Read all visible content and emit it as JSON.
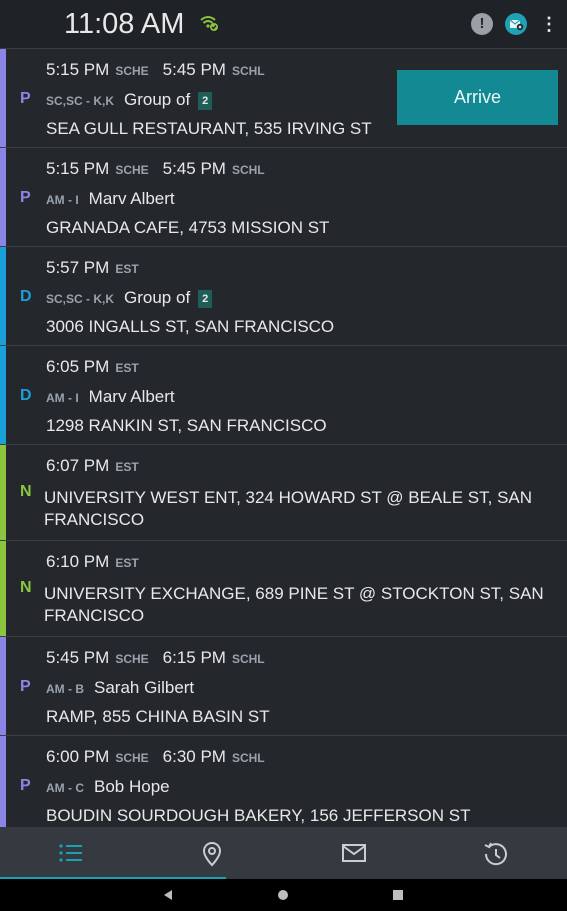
{
  "status": {
    "time": "11:08 AM",
    "alert_glyph": "!",
    "menu_glyph": "⋮"
  },
  "colors": {
    "pickup": "#8b86e6",
    "dropoff": "#1aa0d8",
    "note": "#8cc63f",
    "accent": "#138a93"
  },
  "rows": [
    {
      "type": "P",
      "time1": "5:15 PM",
      "tag1": "SCHE",
      "time2": "5:45 PM",
      "tag2": "SCHL",
      "code": "SC,SC - K,K",
      "name": "Group of",
      "count": "2",
      "address": "SEA GULL RESTAURANT, 535 IRVING ST",
      "action": "Arrive"
    },
    {
      "type": "P",
      "time1": "5:15 PM",
      "tag1": "SCHE",
      "time2": "5:45 PM",
      "tag2": "SCHL",
      "code": "AM - I",
      "name": "Marv Albert",
      "address": "GRANADA CAFE, 4753 MISSION ST"
    },
    {
      "type": "D",
      "time1": "5:57 PM",
      "tag1": "EST",
      "code": "SC,SC - K,K",
      "name": "Group of",
      "count": "2",
      "address": "3006 INGALLS ST, SAN FRANCISCO"
    },
    {
      "type": "D",
      "time1": "6:05 PM",
      "tag1": "EST",
      "code": "AM - I",
      "name": "Marv Albert",
      "address": "1298 RANKIN ST, SAN FRANCISCO"
    },
    {
      "type": "N",
      "time1": "6:07 PM",
      "tag1": "EST",
      "address": "UNIVERSITY WEST ENT, 324 HOWARD ST  @ BEALE ST, SAN FRANCISCO"
    },
    {
      "type": "N",
      "time1": "6:10 PM",
      "tag1": "EST",
      "address": "UNIVERSITY EXCHANGE, 689 PINE ST  @ STOCKTON ST, SAN FRANCISCO"
    },
    {
      "type": "P",
      "time1": "5:45 PM",
      "tag1": "SCHE",
      "time2": "6:15 PM",
      "tag2": "SCHL",
      "code": "AM - B",
      "name": "Sarah Gilbert",
      "address": "RAMP, 855 CHINA BASIN ST"
    },
    {
      "type": "P",
      "time1": "6:00 PM",
      "tag1": "SCHE",
      "time2": "6:30 PM",
      "tag2": "SCHL",
      "code": "AM - C",
      "name": "Bob Hope",
      "address": "BOUDIN SOURDOUGH BAKERY, 156 JEFFERSON ST"
    }
  ],
  "nav": {
    "tabs": [
      "list-icon",
      "location-pin-icon",
      "mail-icon",
      "history-icon"
    ],
    "active": 0
  }
}
